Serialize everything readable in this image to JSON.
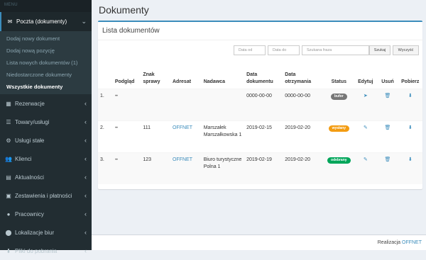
{
  "sidebar": {
    "menu_label": "MENU",
    "active_section": "Poczta (dokumenty)",
    "sub_items": [
      "Dodaj nowy dokument",
      "Dodaj nową pozycję",
      "Lista nowych dokumentów (1)",
      "Niedostarczone dokumenty",
      "Wszystkie dokumenty"
    ],
    "items": [
      {
        "label": "Rezerwacje",
        "icon": "calendar-icon",
        "glyph": "▦"
      },
      {
        "label": "Towary/usługi",
        "icon": "list-icon",
        "glyph": "☰"
      },
      {
        "label": "Usługi stałe",
        "icon": "cog-icon",
        "glyph": "⚙"
      },
      {
        "label": "Klienci",
        "icon": "users-icon",
        "glyph": "👥"
      },
      {
        "label": "Aktualności",
        "icon": "news-icon",
        "glyph": "▤"
      },
      {
        "label": "Zestawienia i płatności",
        "icon": "money-icon",
        "glyph": "▣"
      },
      {
        "label": "Pracownicy",
        "icon": "car-icon",
        "glyph": "●"
      },
      {
        "label": "Lokalizacje biur",
        "icon": "map-marker-icon",
        "glyph": "⬤"
      },
      {
        "label": "Pliki do pobrania",
        "icon": "download-icon",
        "glyph": "⬇"
      }
    ]
  },
  "page_title": "Dokumenty",
  "box_title": "Lista dokumentów",
  "filters": {
    "date_from": "Data od",
    "date_to": "Data do",
    "phrase": "Szukana fraza",
    "search": "Szukaj",
    "clear": "Wyczyść"
  },
  "table": {
    "headers": [
      "",
      "Podgląd",
      "Znak sprawy",
      "Adresat",
      "Nadawca",
      "Data dokumentu",
      "Data otrzymania",
      "Status",
      "Edytuj",
      "Usuń",
      "Pobierz"
    ],
    "rows": [
      {
        "num": "1.",
        "znak": "",
        "adresat": "",
        "nadawca": "",
        "data_dok": "0000-00-00",
        "data_otrz": "0000-00-00",
        "status": "bufor",
        "status_color": "#777777",
        "edit_icon": "send-icon"
      },
      {
        "num": "2.",
        "znak": "111",
        "adresat": "OFFNET",
        "nadawca": "Marszałek Marszałkowska 1",
        "data_dok": "2019-02-15",
        "data_otrz": "2019-02-20",
        "status": "wysłany",
        "status_color": "#f39c12",
        "edit_icon": "edit-icon"
      },
      {
        "num": "3.",
        "znak": "123",
        "adresat": "OFFNET",
        "nadawca": "Biuro turystyczne Polna 1",
        "data_dok": "2019-02-19",
        "data_otrz": "2019-02-20",
        "status": "odebrany",
        "status_color": "#00a65a",
        "edit_icon": "edit-icon"
      }
    ]
  },
  "footer": {
    "label": "Realizacja",
    "link": "OFFNET"
  }
}
